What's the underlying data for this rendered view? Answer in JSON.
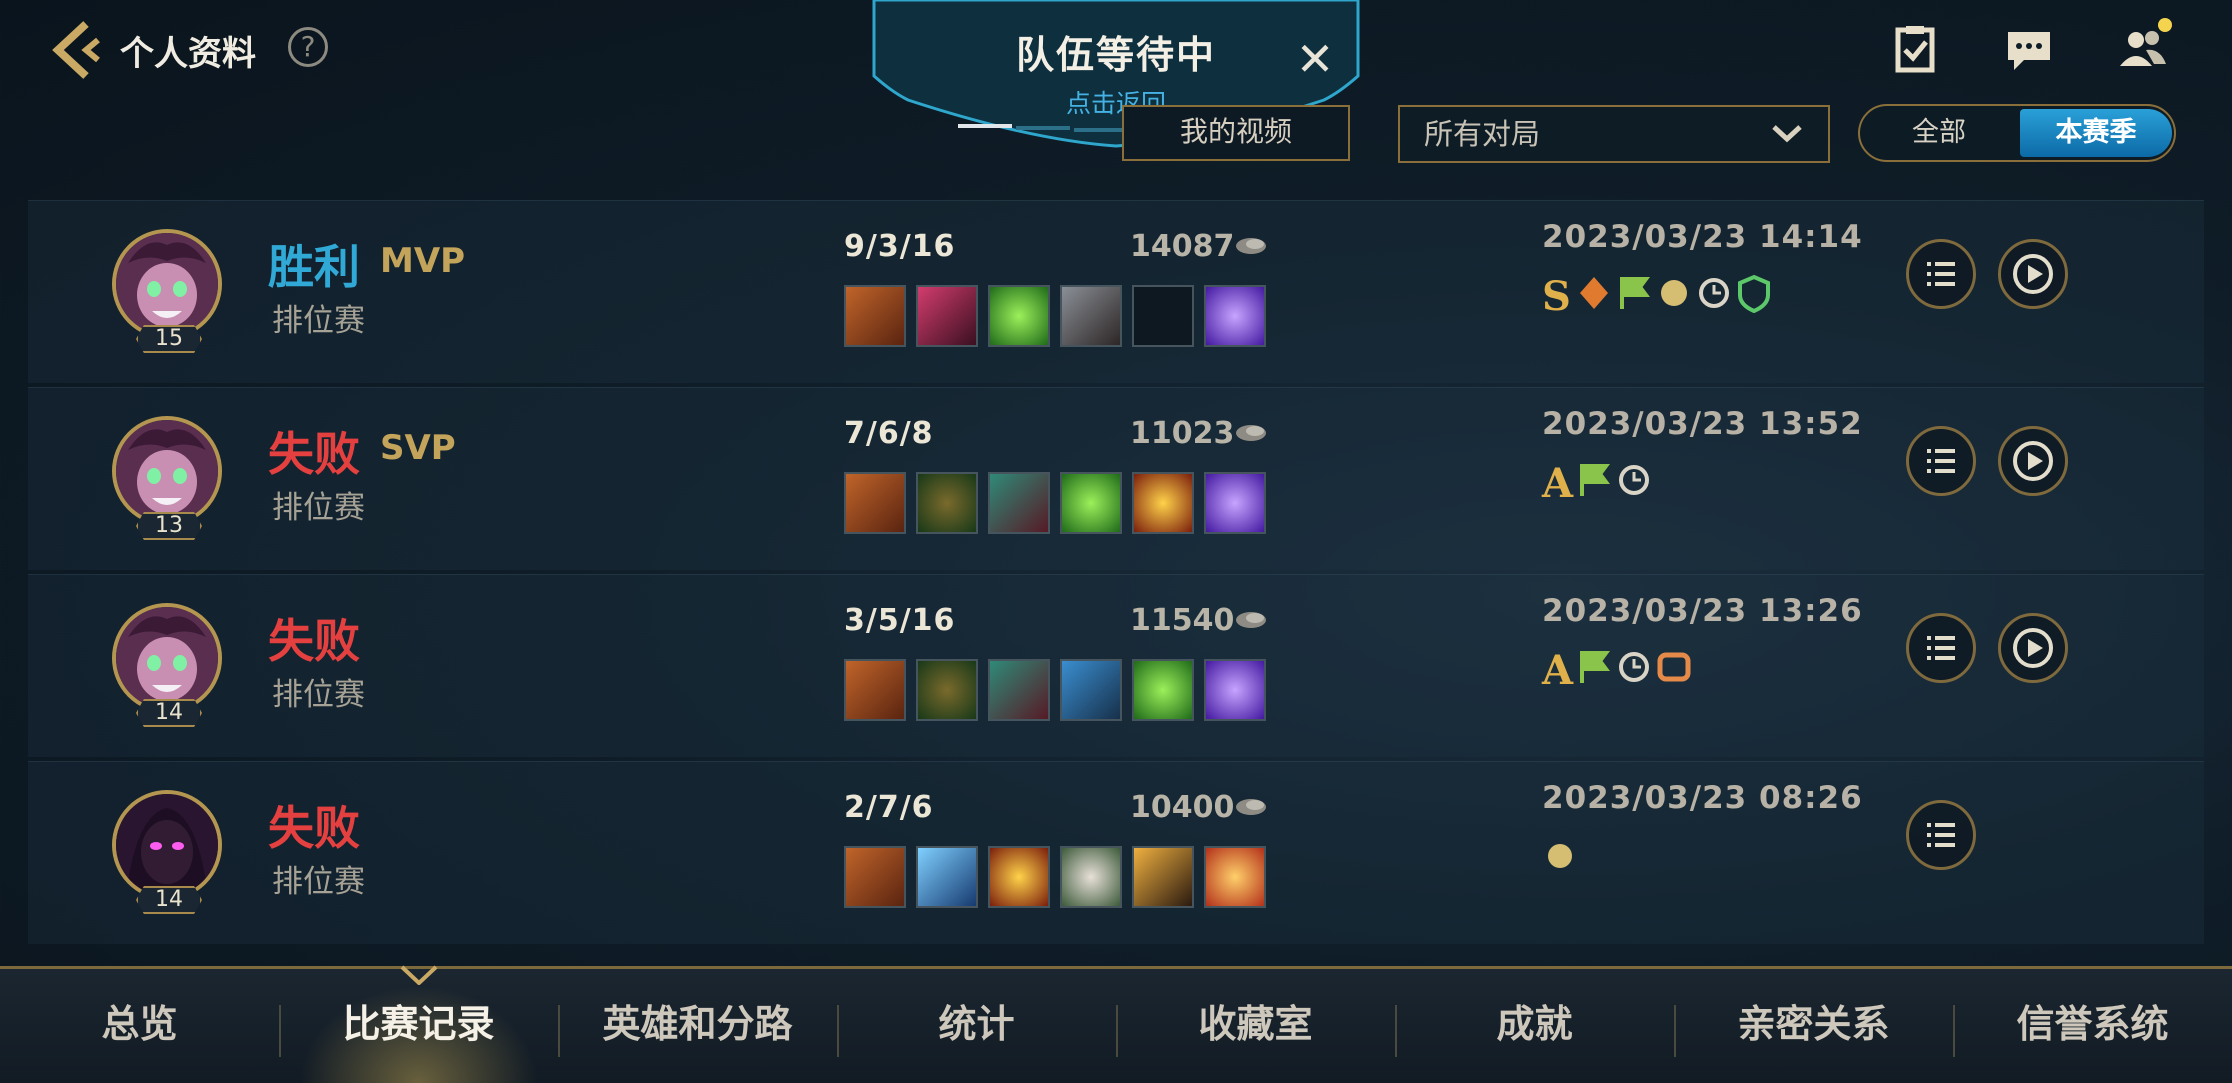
{
  "header": {
    "title": "个人资料",
    "help": "?"
  },
  "queue": {
    "title": "队伍等待中",
    "subtitle": "点击返回",
    "close": "✕"
  },
  "filters": {
    "videos_label": "我的视频",
    "mode_select": "所有对局",
    "season_all": "全部",
    "season_current": "本赛季"
  },
  "matches": [
    {
      "result": "胜利",
      "honor": "MVP",
      "mode": "排位赛",
      "level": "15",
      "kda": "9/3/16",
      "gold": "14087",
      "datetime": "2023/03/23 14:14",
      "grade": "S",
      "has_replay": true
    },
    {
      "result": "失败",
      "honor": "SVP",
      "mode": "排位赛",
      "level": "13",
      "kda": "7/6/8",
      "gold": "11023",
      "datetime": "2023/03/23 13:52",
      "grade": "A",
      "has_replay": true
    },
    {
      "result": "失败",
      "honor": "",
      "mode": "排位赛",
      "level": "14",
      "kda": "3/5/16",
      "gold": "11540",
      "datetime": "2023/03/23 13:26",
      "grade": "A",
      "has_replay": true
    },
    {
      "result": "失败",
      "honor": "",
      "mode": "排位赛",
      "level": "14",
      "kda": "2/7/6",
      "gold": "10400",
      "datetime": "2023/03/23 08:26",
      "grade": "",
      "has_replay": false
    }
  ],
  "nav": {
    "tabs": [
      "总览",
      "比赛记录",
      "英雄和分路",
      "统计",
      "收藏室",
      "成就",
      "亲密关系",
      "信誉系统"
    ],
    "active": "比赛记录"
  },
  "colors": {
    "win": "#31a9d6",
    "loss": "#e4403f",
    "gold_accent": "#b49650",
    "active_toggle": "#1a86c4"
  }
}
